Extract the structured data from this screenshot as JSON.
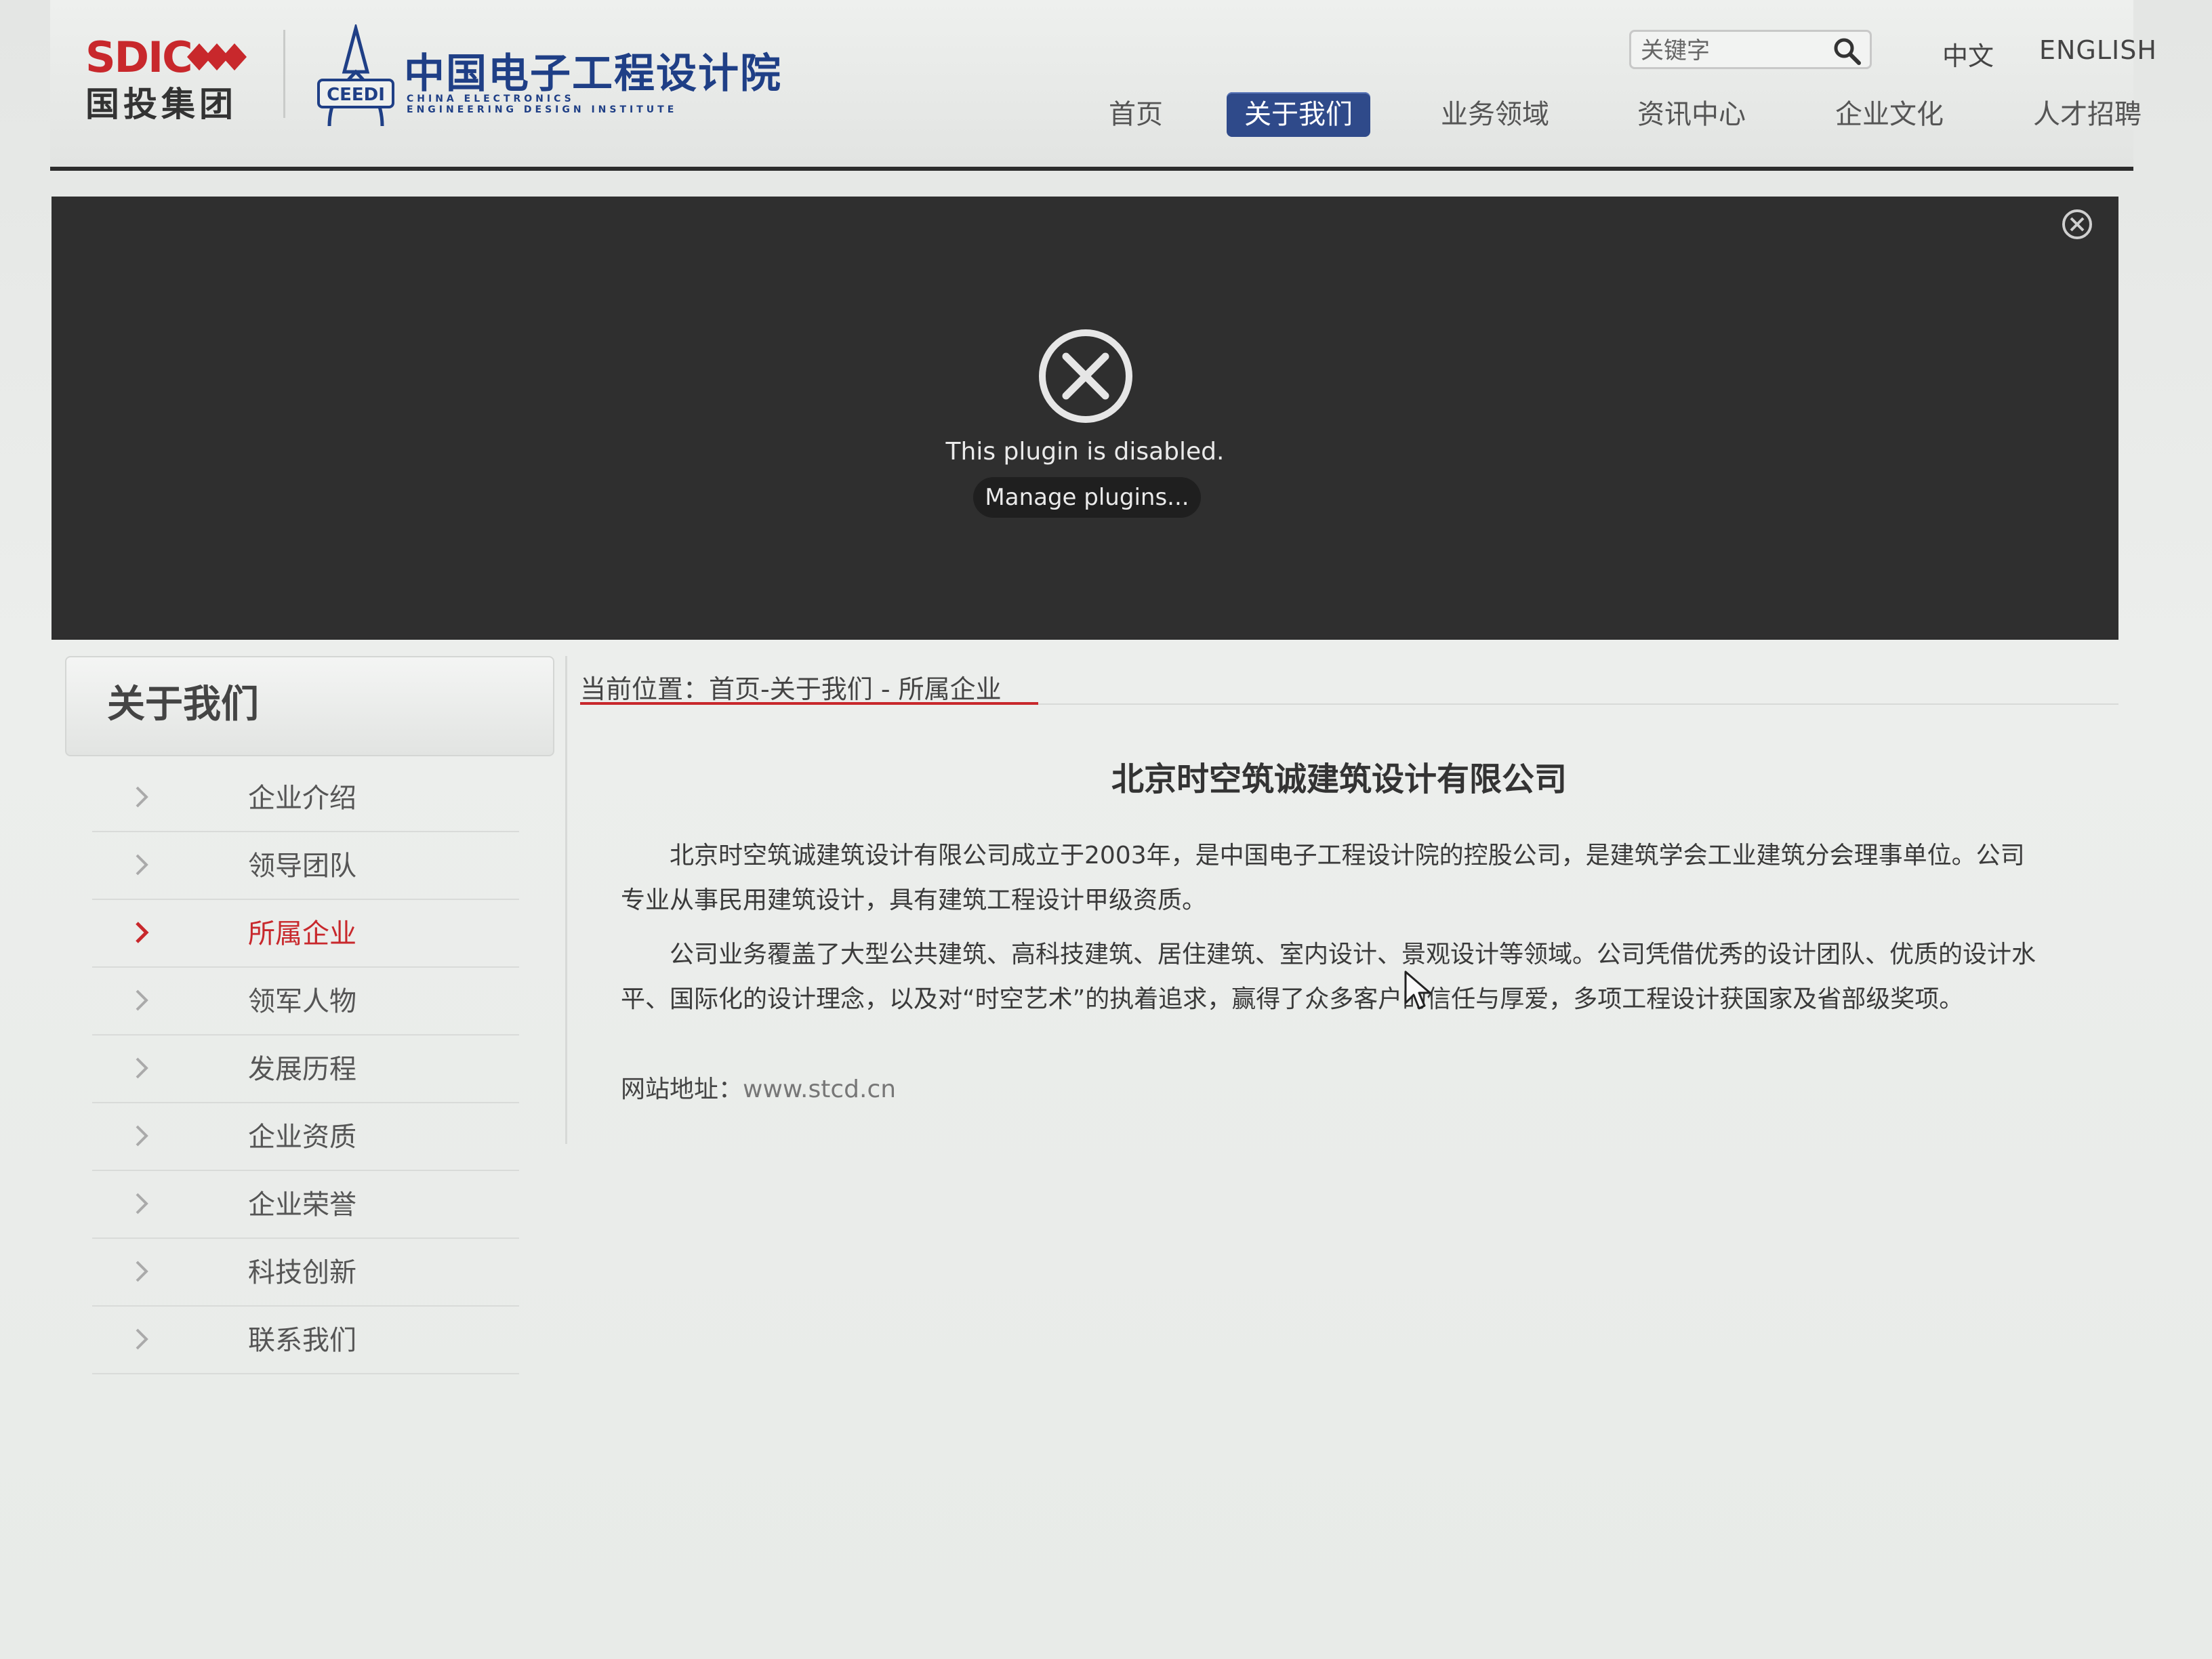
{
  "header": {
    "sdic_logo_text": "SDIC",
    "sdic_logo_cn": "国投集团",
    "ceedi_logo_badge": "CEEDI",
    "ceedi_logo_cn": "中国电子工程设计院",
    "ceedi_logo_en_line1": "CHINA ELECTRONICS",
    "ceedi_logo_en_line2": "ENGINEERING DESIGN INSTITUTE",
    "search": {
      "placeholder": "关键字",
      "icon": "search-icon"
    },
    "lang": {
      "cn": "中文",
      "en": "ENGLISH"
    },
    "nav": [
      {
        "label": "首页",
        "active": false
      },
      {
        "label": "关于我们",
        "active": true
      },
      {
        "label": "业务领域",
        "active": false
      },
      {
        "label": "资讯中心",
        "active": false
      },
      {
        "label": "企业文化",
        "active": false
      },
      {
        "label": "人才招聘",
        "active": false
      }
    ]
  },
  "plugin": {
    "message": "This plugin is disabled.",
    "button": "Manage plugins..."
  },
  "sidebar": {
    "title": "关于我们",
    "items": [
      {
        "label": "企业介绍",
        "active": false
      },
      {
        "label": "领导团队",
        "active": false
      },
      {
        "label": "所属企业",
        "active": true
      },
      {
        "label": "领军人物",
        "active": false
      },
      {
        "label": "发展历程",
        "active": false
      },
      {
        "label": "企业资质",
        "active": false
      },
      {
        "label": "企业荣誉",
        "active": false
      },
      {
        "label": "科技创新",
        "active": false
      },
      {
        "label": "联系我们",
        "active": false
      }
    ]
  },
  "main": {
    "breadcrumb": {
      "prefix": "当前位置：",
      "home": "首页",
      "sep1": "-",
      "about": "关于我们",
      "sep2": " - ",
      "current": "所属企业"
    },
    "title": "北京时空筑诚建筑设计有限公司",
    "paragraph1": "北京时空筑诚建筑设计有限公司成立于2003年，是中国电子工程设计院的控股公司，是建筑学会工业建筑分会理事单位。公司专业从事民用建筑设计，具有建筑工程设计甲级资质。",
    "paragraph2": "公司业务覆盖了大型公共建筑、高科技建筑、居住建筑、室内设计、景观设计等领域。公司凭借优秀的设计团队、优质的设计水平、国际化的设计理念，以及对“时空艺术”的执着追求，赢得了众多客户的信任与厚爱，多项工程设计获国家及省部级奖项。",
    "website_label": "网站地址：",
    "website_url": "www.stcd.cn"
  },
  "colors": {
    "accent_red": "#c8282c",
    "nav_active_bg": "#2f4a8a",
    "plugin_bg": "#2f2f2f",
    "logo_blue": "#1f3f86"
  }
}
